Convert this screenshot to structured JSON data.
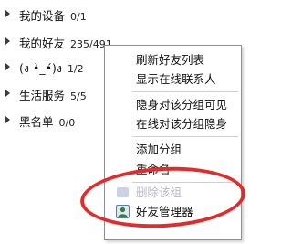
{
  "groups": [
    {
      "name": "我的设备",
      "count": "0/1"
    },
    {
      "name": "我的好友",
      "count": "235/491"
    },
    {
      "name": "(ง •̀_•́)ง",
      "count": "1/2"
    },
    {
      "name": "生活服务",
      "count": "5/5"
    },
    {
      "name": "黑名单",
      "count": "0/0"
    }
  ],
  "menu": {
    "items": [
      {
        "label": "刷新好友列表"
      },
      {
        "label": "显示在线联系人"
      },
      {
        "label": "隐身对该分组可见"
      },
      {
        "label": "在线对该分组隐身"
      },
      {
        "label": "添加分组"
      },
      {
        "label": "重命名"
      },
      {
        "label": "删除该组"
      },
      {
        "label": "好友管理器"
      }
    ]
  },
  "colors": {
    "highlight": "#e32b2b",
    "menu_border": "#8f8f8f",
    "separator": "#cfcfcf",
    "text": "#111111"
  },
  "icons": {
    "group_expander": "triangle-right-icon",
    "delete_group": "blurred-delete-icon",
    "friend_manager": "person-card-icon"
  }
}
